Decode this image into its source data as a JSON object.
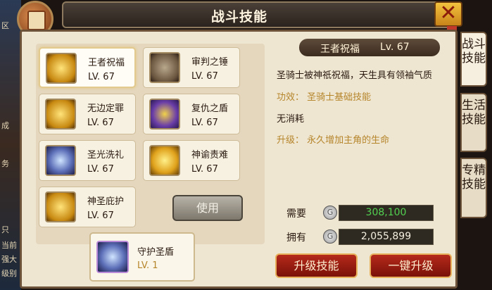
{
  "window": {
    "title": "战斗技能",
    "close_label": "✕"
  },
  "left_strip": {
    "text": [
      "区",
      "成",
      "务",
      "只",
      "当前",
      "强大",
      "级别"
    ]
  },
  "skills": [
    {
      "name": "王者祝福",
      "level": "LV. 67",
      "icon": "crown-icon",
      "selected": true
    },
    {
      "name": "审判之锤",
      "level": "LV. 67",
      "icon": "hammer-icon"
    },
    {
      "name": "无边定罪",
      "level": "LV. 67",
      "icon": "cross-shield-icon"
    },
    {
      "name": "复仇之盾",
      "level": "LV. 67",
      "icon": "shield-icon"
    },
    {
      "name": "圣光洗礼",
      "level": "LV. 67",
      "icon": "light-icon"
    },
    {
      "name": "神谕责难",
      "level": "LV. 67",
      "icon": "golden-hammer-icon"
    },
    {
      "name": "神圣庇护",
      "level": "LV. 67",
      "icon": "praying-hands-icon"
    }
  ],
  "use_button": "使用",
  "equipped": {
    "name": "守护圣盾",
    "level": "LV. 1",
    "icon": "guardian-shield-icon"
  },
  "detail": {
    "name": "王者祝福",
    "level": "Lv. 67",
    "description": "圣骑士被神祇祝福，天生具有领袖气质",
    "effect": "功效：  圣骑士基础技能",
    "cost": "无消耗",
    "upgrade": "升级：  永久增加主角的生命"
  },
  "resources": {
    "need_label": "需要",
    "need_value": "308,100",
    "own_label": "拥有",
    "own_value": "2,055,899",
    "coin_symbol": "G"
  },
  "buttons": {
    "upgrade": "升级技能",
    "one_click": "一键升级"
  },
  "side_tabs": [
    "战斗技能",
    "生活技能",
    "专精技能"
  ],
  "colors": {
    "accent_red": "#b52a1b",
    "gold_text": "#b5852a",
    "need_green": "#52d050"
  }
}
